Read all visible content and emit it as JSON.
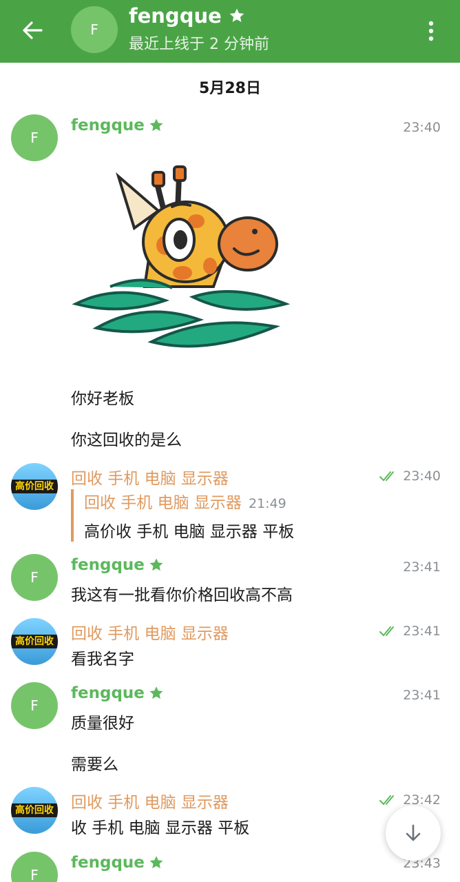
{
  "header": {
    "avatar_letter": "F",
    "name": "fengque",
    "status": "最近上线于 2 分钟前"
  },
  "date": "5月28日",
  "messages": [
    {
      "sender": "fengque",
      "time": "23:40",
      "avatar": "F"
    },
    {
      "text": "你好老板"
    },
    {
      "text": "你这回收的是么"
    },
    {
      "sender": "回收 手机 电脑 显示器",
      "time": "23:40",
      "avatar_label": "高价回收",
      "reply": {
        "sender": "回收 手机 电脑 显示器",
        "time": "21:49",
        "text": "高价收 手机 电脑 显示器 平板"
      }
    },
    {
      "sender": "fengque",
      "time": "23:41",
      "avatar": "F",
      "text": "我这有一批看你价格回收高不高"
    },
    {
      "sender": "回收 手机 电脑 显示器",
      "time": "23:41",
      "avatar_label": "高价回收",
      "text": "看我名字"
    },
    {
      "sender": "fengque",
      "time": "23:41",
      "avatar": "F",
      "text": "质量很好"
    },
    {
      "text": "需要么"
    },
    {
      "sender": "回收 手机 电脑 显示器",
      "time": "23:42",
      "avatar_label": "高价回收",
      "text": "收 手机 电脑 显示器 平板"
    },
    {
      "sender": "fengque",
      "time": "23:43",
      "avatar": "F"
    }
  ],
  "colors": {
    "header": "#4aa446",
    "sender_green": "#5cb85c",
    "sender_orange": "#e09a5f"
  },
  "icons": [
    "back-arrow-icon",
    "star-icon",
    "more-vert-icon",
    "double-check-icon",
    "arrow-down-icon"
  ]
}
